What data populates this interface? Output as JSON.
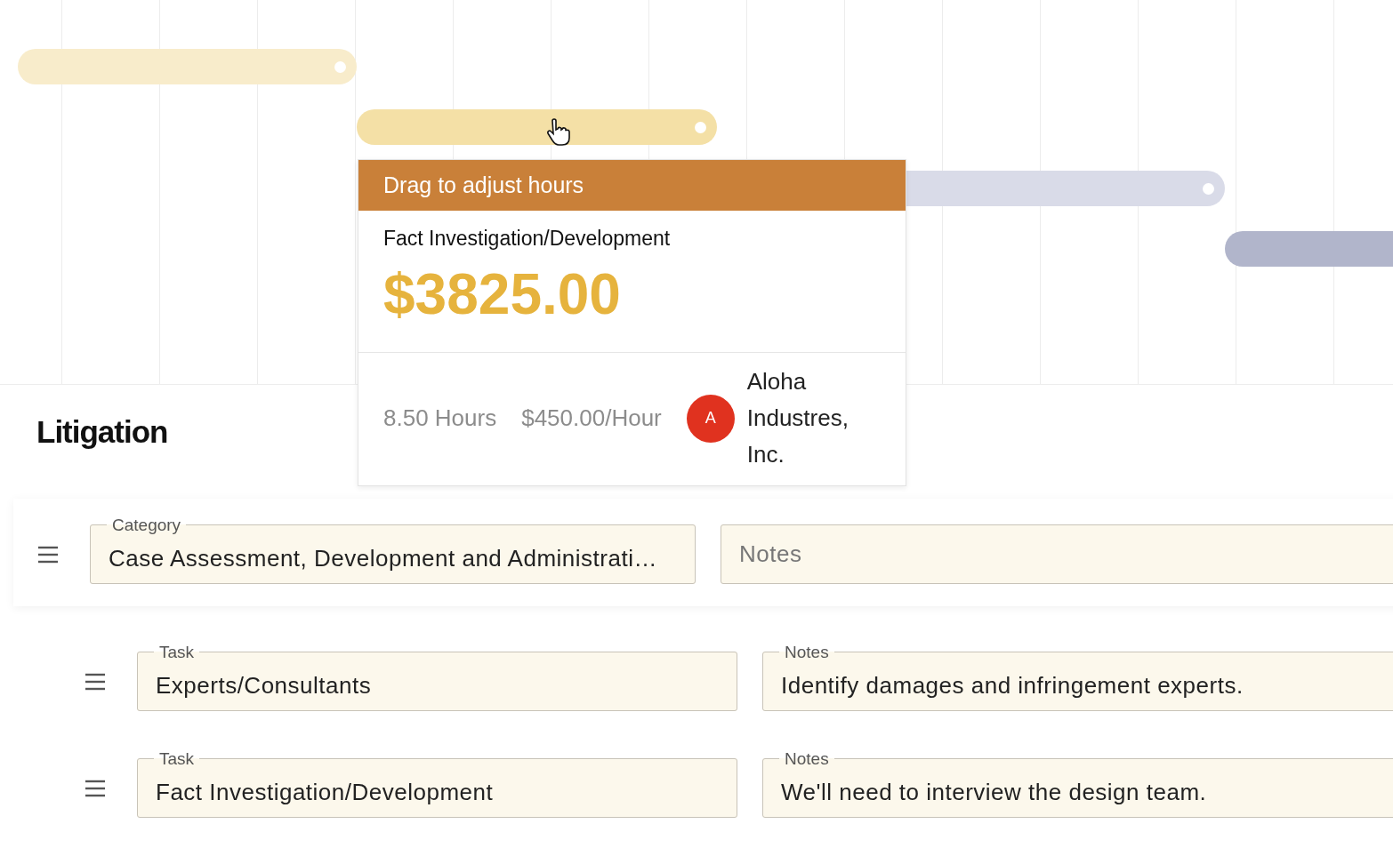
{
  "timeline": {
    "bars": [
      {
        "color": "#f8eccb"
      },
      {
        "color": "#f4e0a6"
      },
      {
        "color": "#d9dbe8"
      },
      {
        "color": "#b1b5cb"
      }
    ]
  },
  "tooltip": {
    "header": "Drag to adjust hours",
    "task": "Fact Investigation/Development",
    "amount": "$3825.00",
    "hours": "8.50 Hours",
    "rate": "$450.00/Hour",
    "avatar": "A",
    "client": "Aloha Industres, Inc."
  },
  "section": {
    "title": "Litigation"
  },
  "category_row": {
    "category": {
      "label": "Category",
      "value": "Case Assessment, Development and Administrati…"
    },
    "notes": {
      "placeholder": "Notes"
    }
  },
  "task_rows": [
    {
      "task": {
        "label": "Task",
        "value": "Experts/Consultants"
      },
      "notes": {
        "label": "Notes",
        "value": "Identify damages and infringement experts."
      }
    },
    {
      "task": {
        "label": "Task",
        "value": "Fact Investigation/Development"
      },
      "notes": {
        "label": "Notes",
        "value": "We'll need to interview the design team."
      }
    }
  ]
}
